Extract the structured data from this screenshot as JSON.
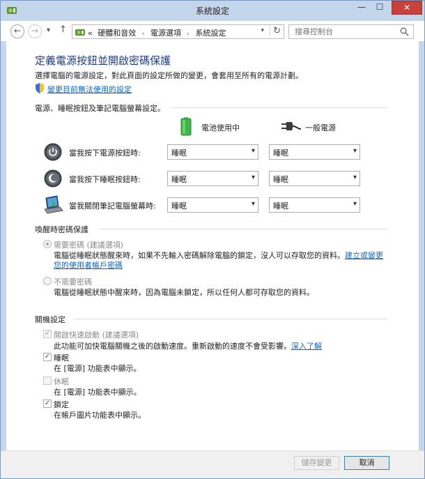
{
  "window": {
    "title": "系統設定",
    "controls": {
      "minimize": "—",
      "maximize": "☐",
      "close": "✕"
    }
  },
  "nav": {
    "back": "←",
    "forward": "→",
    "recent": "▾",
    "up": "↑",
    "breadcrumb_prefix": "«",
    "breadcrumbs": [
      "硬體和音效",
      "電源選項",
      "系統設定"
    ],
    "crumb_separator": "›",
    "address_dropdown": "▾",
    "refresh": "↻",
    "search_placeholder": "搜尋控制台"
  },
  "page": {
    "title": "定義電源按鈕並開啟密碼保護",
    "description": "選擇電腦的電源設定，對此頁面的設定所做的變更，會套用至所有的電源計劃。",
    "admin_link": "變更目前無法使用的設定"
  },
  "power_section": {
    "title": "電源、睡眠按鈕及筆記電腦螢幕設定。",
    "col_battery": "電池使用中",
    "col_plugged": "一般電源",
    "rows": [
      {
        "label": "當我按下電源按鈕時:",
        "battery": "睡眠",
        "plugged": "睡眠",
        "icon": "power-button-icon"
      },
      {
        "label": "當我按下睡眠按鈕時:",
        "battery": "睡眠",
        "plugged": "睡眠",
        "icon": "sleep-button-icon"
      },
      {
        "label": "當我關閉筆記電腦螢幕時:",
        "battery": "睡眠",
        "plugged": "睡眠",
        "icon": "laptop-lid-icon"
      }
    ],
    "dropdown_arrow": "▾"
  },
  "wake_section": {
    "title": "喚醒時密碼保護",
    "require": {
      "label": "需要密碼 (建議選項)",
      "desc_line1": "電腦從睡眠狀態醒來時，如果不先輸入密碼解除電腦的鎖定，沒人可以存取您的資料。",
      "link_part1": "建立或變更",
      "link_part2": "您的使用者帳戶密碼",
      "checked": true
    },
    "no_require": {
      "label": "不需要密碼",
      "desc": "電腦從睡眠狀態中醒來時，因為電腦未鎖定，所以任何人都可存取您的資料。",
      "checked": false
    }
  },
  "shutdown_section": {
    "title": "關機設定",
    "check_mark": "✓",
    "items": [
      {
        "label": "開啟快速啟動 (建議選項)",
        "desc": "此功能可加快電腦關機之後的啟動速度。重新啟動的速度不會受影響。",
        "link": "深入了解",
        "checked": true,
        "disabled": true
      },
      {
        "label": "睡眠",
        "desc": "在 [電源] 功能表中顯示。",
        "checked": true,
        "disabled": true
      },
      {
        "label": "休眠",
        "desc": "在 [電源] 功能表中顯示。",
        "checked": false,
        "disabled": true
      },
      {
        "label": "鎖定",
        "desc": "在帳戶圖片功能表中顯示。",
        "checked": true,
        "disabled": true
      }
    ]
  },
  "footer": {
    "save": "儲存變更",
    "cancel": "取消"
  },
  "colors": {
    "title_blue": "#1e3c8c",
    "link_blue": "#0f66c7",
    "frame": "#c4d6ec",
    "close_red": "#c7423a",
    "battery_green": "#3fb447"
  }
}
